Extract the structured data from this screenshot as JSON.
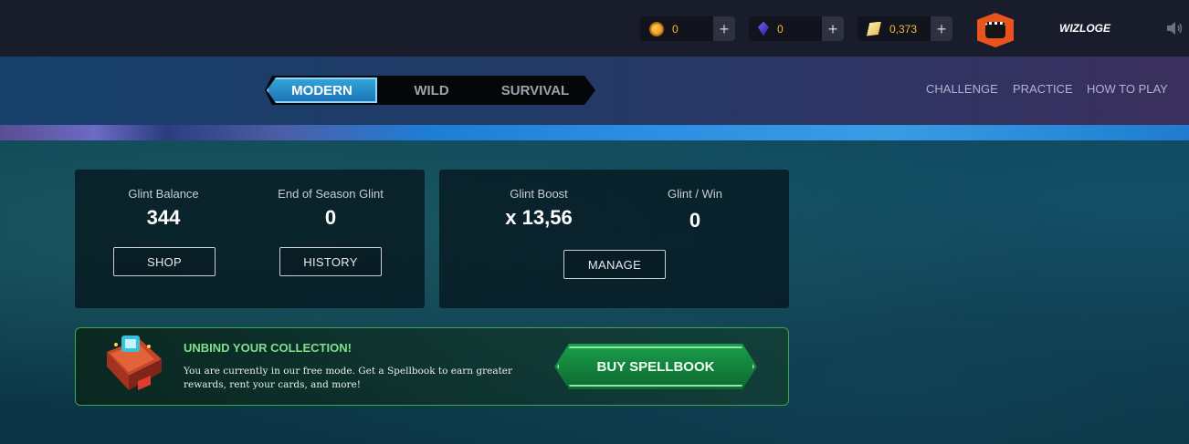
{
  "topbar": {
    "currencies": [
      {
        "name": "credits",
        "value": "0",
        "icon": "coin-icon",
        "add_label": "+"
      },
      {
        "name": "dec",
        "value": "0",
        "icon": "gem-icon",
        "add_label": "+"
      },
      {
        "name": "glint",
        "value": "0,373",
        "icon": "glint-icon",
        "add_label": "+"
      }
    ],
    "username": "WIZLOGE"
  },
  "nav": {
    "modes": [
      "MODERN",
      "WILD",
      "SURVIVAL"
    ],
    "active_mode": "MODERN",
    "links": [
      "CHALLENGE",
      "PRACTICE",
      "HOW TO PLAY"
    ]
  },
  "glint_panel": {
    "balance_label": "Glint Balance",
    "balance_value": "344",
    "end_label": "End of Season Glint",
    "end_value": "0",
    "shop_button": "SHOP",
    "history_button": "HISTORY"
  },
  "boost_panel": {
    "boost_label": "Glint Boost",
    "boost_value": "x 13,56",
    "per_win_label": "Glint / Win",
    "per_win_value": "0",
    "manage_button": "MANAGE"
  },
  "banner": {
    "title": "UNBIND YOUR COLLECTION!",
    "text": "You are currently in our free mode. Get a Spellbook to earn greater rewards, rent your cards, and more!",
    "button": "BUY SPELLBOOK"
  },
  "colors": {
    "accent_blue": "#1b72b8",
    "currency_text": "#f3b63c",
    "banner_green": "#3fa64a",
    "avatar_orange": "#e8541b"
  }
}
